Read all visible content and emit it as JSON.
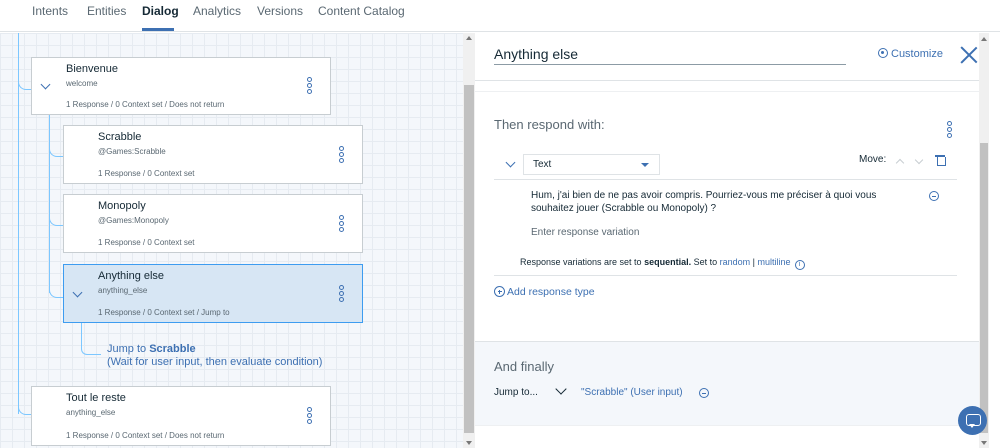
{
  "nav": {
    "tabs": [
      "Intents",
      "Entities",
      "Dialog",
      "Analytics",
      "Versions",
      "Content Catalog"
    ],
    "active": "Dialog"
  },
  "tree": {
    "nodes": [
      {
        "title": "Bienvenue",
        "condition": "welcome",
        "meta": "1 Response / 0 Context set / Does not return"
      },
      {
        "title": "Scrabble",
        "condition": "@Games:Scrabble",
        "meta": "1 Response / 0 Context set"
      },
      {
        "title": "Monopoly",
        "condition": "@Games:Monopoly",
        "meta": "1 Response / 0 Context set"
      },
      {
        "title": "Anything else",
        "condition": "anything_else",
        "meta": "1 Response / 0 Context set / Jump to"
      },
      {
        "title": "Tout le reste",
        "condition": "anything_else",
        "meta": "1 Response / 0 Context set / Does not return"
      }
    ],
    "jump": {
      "prefix": "Jump to ",
      "target": "Scrabble",
      "detail": "(Wait for user input, then evaluate condition)"
    }
  },
  "panel": {
    "node_name": "Anything else",
    "customize_label": "Customize",
    "respond_title": "Then respond with:",
    "response_type": "Text",
    "move_label": "Move:",
    "response_text": "Hum, j'ai bien de ne pas avoir compris. Pourriez-vous me préciser à quoi vous souhaitez jouer (Scrabble ou Monopoly) ?",
    "variation_placeholder": "Enter response variation",
    "seq": {
      "prefix": "Response variations are set to ",
      "mode": "sequential.",
      "middle": " Set to ",
      "random": "random",
      "sep": " | ",
      "multiline": "multiline",
      "info": "i"
    },
    "add_response_label": "Add response type",
    "finally_title": "And finally",
    "jump_label": "Jump to...",
    "jump_target": "\"Scrabble\" (User input)"
  },
  "colors": {
    "accent": "#3d70b2",
    "connector": "#7cc7ff",
    "selected_bg": "#d7e6f4"
  }
}
